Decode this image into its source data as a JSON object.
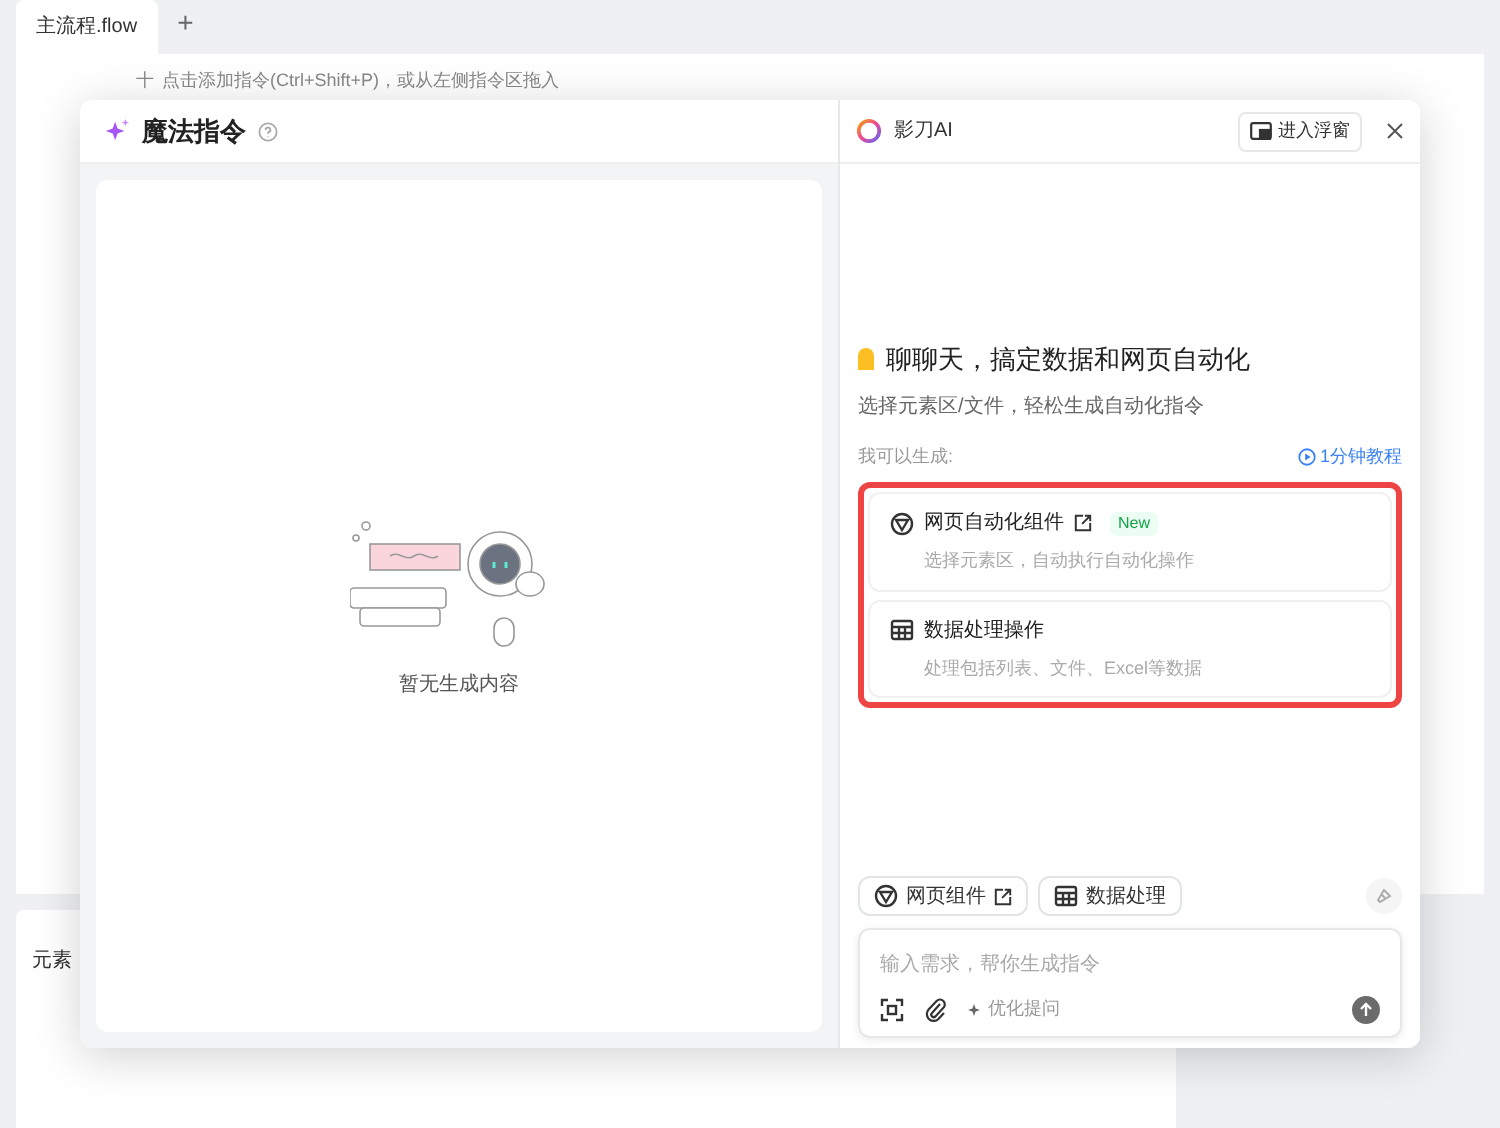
{
  "editor_tabs": [
    {
      "label": "主流程.flow",
      "selected": true
    }
  ],
  "add_tab": "+",
  "canvas_hint": {
    "plus": "十",
    "text": "点击添加指令(Ctrl+Shift+P)，或从左侧指令区拖入"
  },
  "bottom_panel": {
    "title": "元素"
  },
  "left_pane": {
    "title": "魔法指令",
    "empty_text": "暂无生成内容"
  },
  "right_pane": {
    "title": "影刀AI",
    "float_button": "进入浮窗",
    "headline": "聊聊天，搞定数据和网页自动化",
    "subline": "选择元素区/文件，轻松生成自动化指令",
    "can_generate": "我可以生成:",
    "tutorial_link": "1分钟教程",
    "options": [
      {
        "kind": "web",
        "title": "网页自动化组件",
        "external": true,
        "badge": "New",
        "desc": "选择元素区，自动执行自动化操作"
      },
      {
        "kind": "data",
        "title": "数据处理操作",
        "external": false,
        "desc": "处理包括列表、文件、Excel等数据"
      }
    ],
    "chips": [
      {
        "kind": "web",
        "label": "网页组件",
        "external": true
      },
      {
        "kind": "data",
        "label": "数据处理",
        "external": false
      }
    ],
    "input": {
      "placeholder": "输入需求，帮你生成指令",
      "optimize": "优化提问"
    }
  }
}
